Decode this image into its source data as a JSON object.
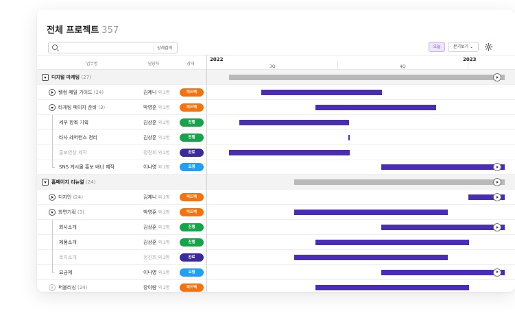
{
  "page": {
    "title": "전체 프로젝트",
    "count": "357"
  },
  "toolbar": {
    "search_placeholder": "",
    "advanced_search_label": "상세검색",
    "today_label": "오늘",
    "quarter_view_label": "분기보기 ⌄"
  },
  "columns": {
    "task": "업무명",
    "owner": "담당자",
    "status": "상태"
  },
  "timeline": {
    "year_left": "2022",
    "year_right": "2023",
    "quarters": [
      "3Q",
      "4Q"
    ]
  },
  "colors": {
    "purple_bar": "#4a2db5",
    "gray_bar": "#b9b9b9",
    "status_feedback": "#f5730f",
    "status_progress": "#16a34a",
    "status_done": "#3b2a9a",
    "status_request": "#1fa0f0"
  },
  "rows": [
    {
      "name": "디지털 마케팅",
      "count": "(27)",
      "type": "group",
      "owner": "",
      "extra": "",
      "status": ""
    },
    {
      "name": "웰컴 메일 가이드",
      "count": "(24)",
      "type": "parent",
      "owner": "김제니",
      "extra": "외 2명",
      "status": "피드백"
    },
    {
      "name": "타게팅 페이지 준비",
      "count": "(3)",
      "type": "parent-open",
      "owner": "박영훈",
      "extra": "외 2명",
      "status": "피드백"
    },
    {
      "name": "세부 항목 기획",
      "count": "",
      "type": "child",
      "owner": "김상훈",
      "extra": "외 2명",
      "status": "진행"
    },
    {
      "name": "타사 레퍼런스 정리",
      "count": "",
      "type": "child",
      "owner": "김상훈",
      "extra": "외 2명",
      "status": "진행"
    },
    {
      "name": "홍보영상 제작",
      "count": "",
      "type": "child-muted",
      "owner": "정진희",
      "extra": "외 2명",
      "status": "완료"
    },
    {
      "name": "SNS 게시물 홍보 배너 제작",
      "count": "",
      "type": "child-last",
      "owner": "이나영",
      "extra": "외 2명",
      "status": "요청"
    },
    {
      "name": "홈페이지 리뉴얼",
      "count": "(24)",
      "type": "group",
      "owner": "",
      "extra": "",
      "status": ""
    },
    {
      "name": "디자인",
      "count": "(24)",
      "type": "parent",
      "owner": "김제니",
      "extra": "외 2명",
      "status": "피드백"
    },
    {
      "name": "화면기획",
      "count": "(3)",
      "type": "parent-open",
      "owner": "박영훈",
      "extra": "외 2명",
      "status": "피드백"
    },
    {
      "name": "회사소개",
      "count": "",
      "type": "child",
      "owner": "김상훈",
      "extra": "외 2명",
      "status": "진행"
    },
    {
      "name": "제품소개",
      "count": "",
      "type": "child",
      "owner": "김상훈",
      "extra": "외 2명",
      "status": "진행"
    },
    {
      "name": "목지소개",
      "count": "",
      "type": "child-muted",
      "owner": "정진희",
      "extra": "외 2명",
      "status": "완료"
    },
    {
      "name": "요금제",
      "count": "",
      "type": "child-last",
      "owner": "이나영",
      "extra": "외 2명",
      "status": "요청"
    },
    {
      "name": "퍼블리싱",
      "count": "(24)",
      "type": "parent-faded",
      "owner": "장이람",
      "extra": "외 2명",
      "status": "피드백"
    }
  ]
}
